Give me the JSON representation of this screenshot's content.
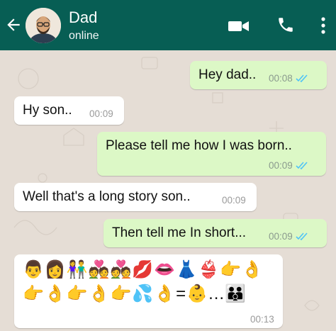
{
  "header": {
    "contact_name": "Dad",
    "status": "online",
    "colors": {
      "bar": "#075e54",
      "icon": "#ffffff"
    },
    "icons": [
      "back-arrow-icon",
      "video-call-icon",
      "phone-icon",
      "more-vert-icon"
    ]
  },
  "chat": {
    "background": "#e5ddd5",
    "outgoing_color": "#dcf8c6",
    "incoming_color": "#ffffff",
    "tick_color": "#4fc3f7",
    "messages": [
      {
        "direction": "out",
        "text": "Hey dad..",
        "time": "00:08",
        "read": true
      },
      {
        "direction": "in",
        "text": "Hy son..",
        "time": "00:09"
      },
      {
        "direction": "out",
        "text": "Please tell me how I was born..",
        "time": "00:09",
        "read": true
      },
      {
        "direction": "in",
        "text": "Well that's a long story son..",
        "time": "00:09"
      },
      {
        "direction": "out",
        "text": "Then tell me In short...",
        "time": "00:09",
        "read": true
      },
      {
        "direction": "in",
        "emoji_line_1": "👨👩👫💑💑💋👄👗👙👉👌",
        "emoji_line_2": "👉👌👉👌👉💦👌=👶...👪",
        "time": "00:13"
      }
    ]
  }
}
